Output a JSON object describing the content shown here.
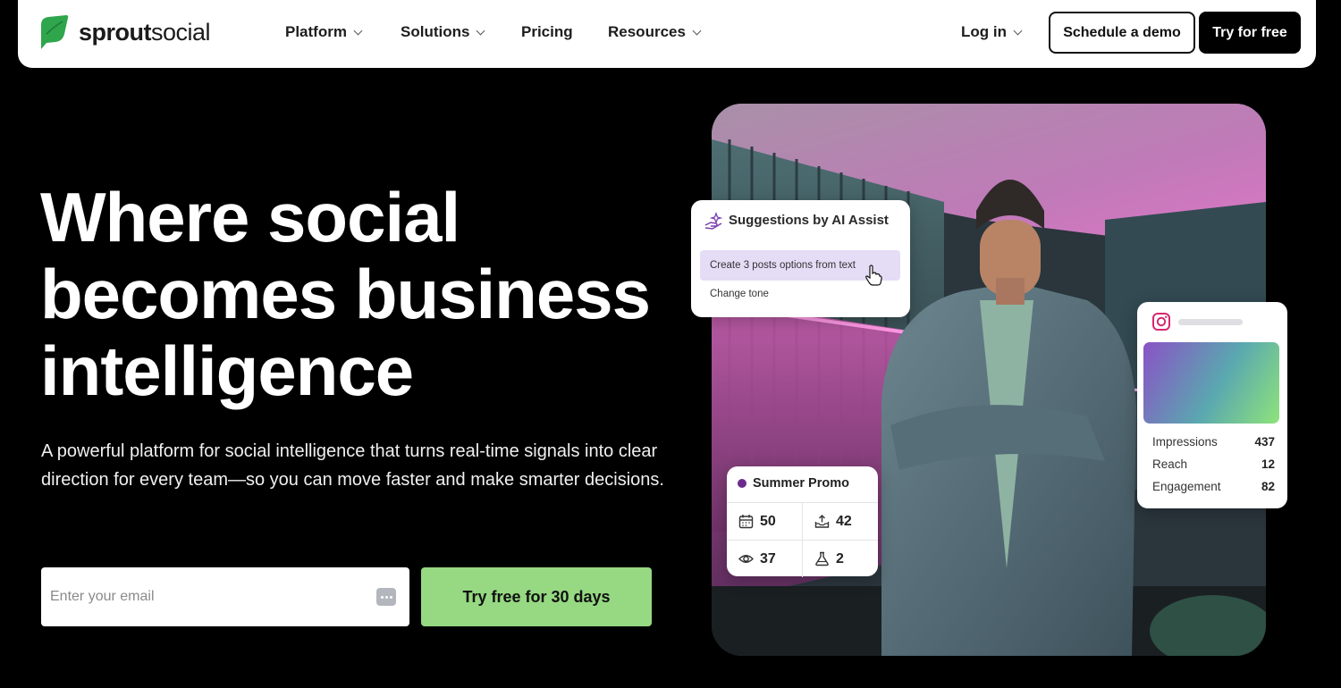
{
  "nav": {
    "logo": {
      "bold": "sprout",
      "light": "social"
    },
    "items": [
      {
        "label": "Platform",
        "has_dropdown": true
      },
      {
        "label": "Solutions",
        "has_dropdown": true
      },
      {
        "label": "Pricing",
        "has_dropdown": false
      },
      {
        "label": "Resources",
        "has_dropdown": true
      }
    ],
    "login": "Log in",
    "schedule_demo": "Schedule a demo",
    "try_free": "Try for free"
  },
  "hero": {
    "title_lines": [
      "Where social",
      "becomes business",
      "intelligence"
    ],
    "subtitle": "A powerful platform for social intelligence that turns real-time signals into clear direction for every team—so you can move faster and make smarter decisions.",
    "email_placeholder": "Enter your email",
    "cta": "Try free for 30 days"
  },
  "ai_card": {
    "title": "Suggestions by AI Assist",
    "option_1": "Create 3 posts options from text",
    "option_2": "Change tone"
  },
  "promo_card": {
    "title": "Summer Promo",
    "stats": [
      {
        "icon": "calendar-icon",
        "value": "50"
      },
      {
        "icon": "upload-icon",
        "value": "42"
      },
      {
        "icon": "eye-icon",
        "value": "37"
      },
      {
        "icon": "flask-icon",
        "value": "2"
      }
    ]
  },
  "ig_card": {
    "metrics": [
      {
        "label": "Impressions",
        "value": "437"
      },
      {
        "label": "Reach",
        "value": "12"
      },
      {
        "label": "Engagement",
        "value": "82"
      }
    ]
  },
  "colors": {
    "accent_green": "#96d982",
    "logo_green": "#2fa54c",
    "ai_highlight": "#e5dcf6",
    "promo_dot": "#6a2c8c"
  }
}
